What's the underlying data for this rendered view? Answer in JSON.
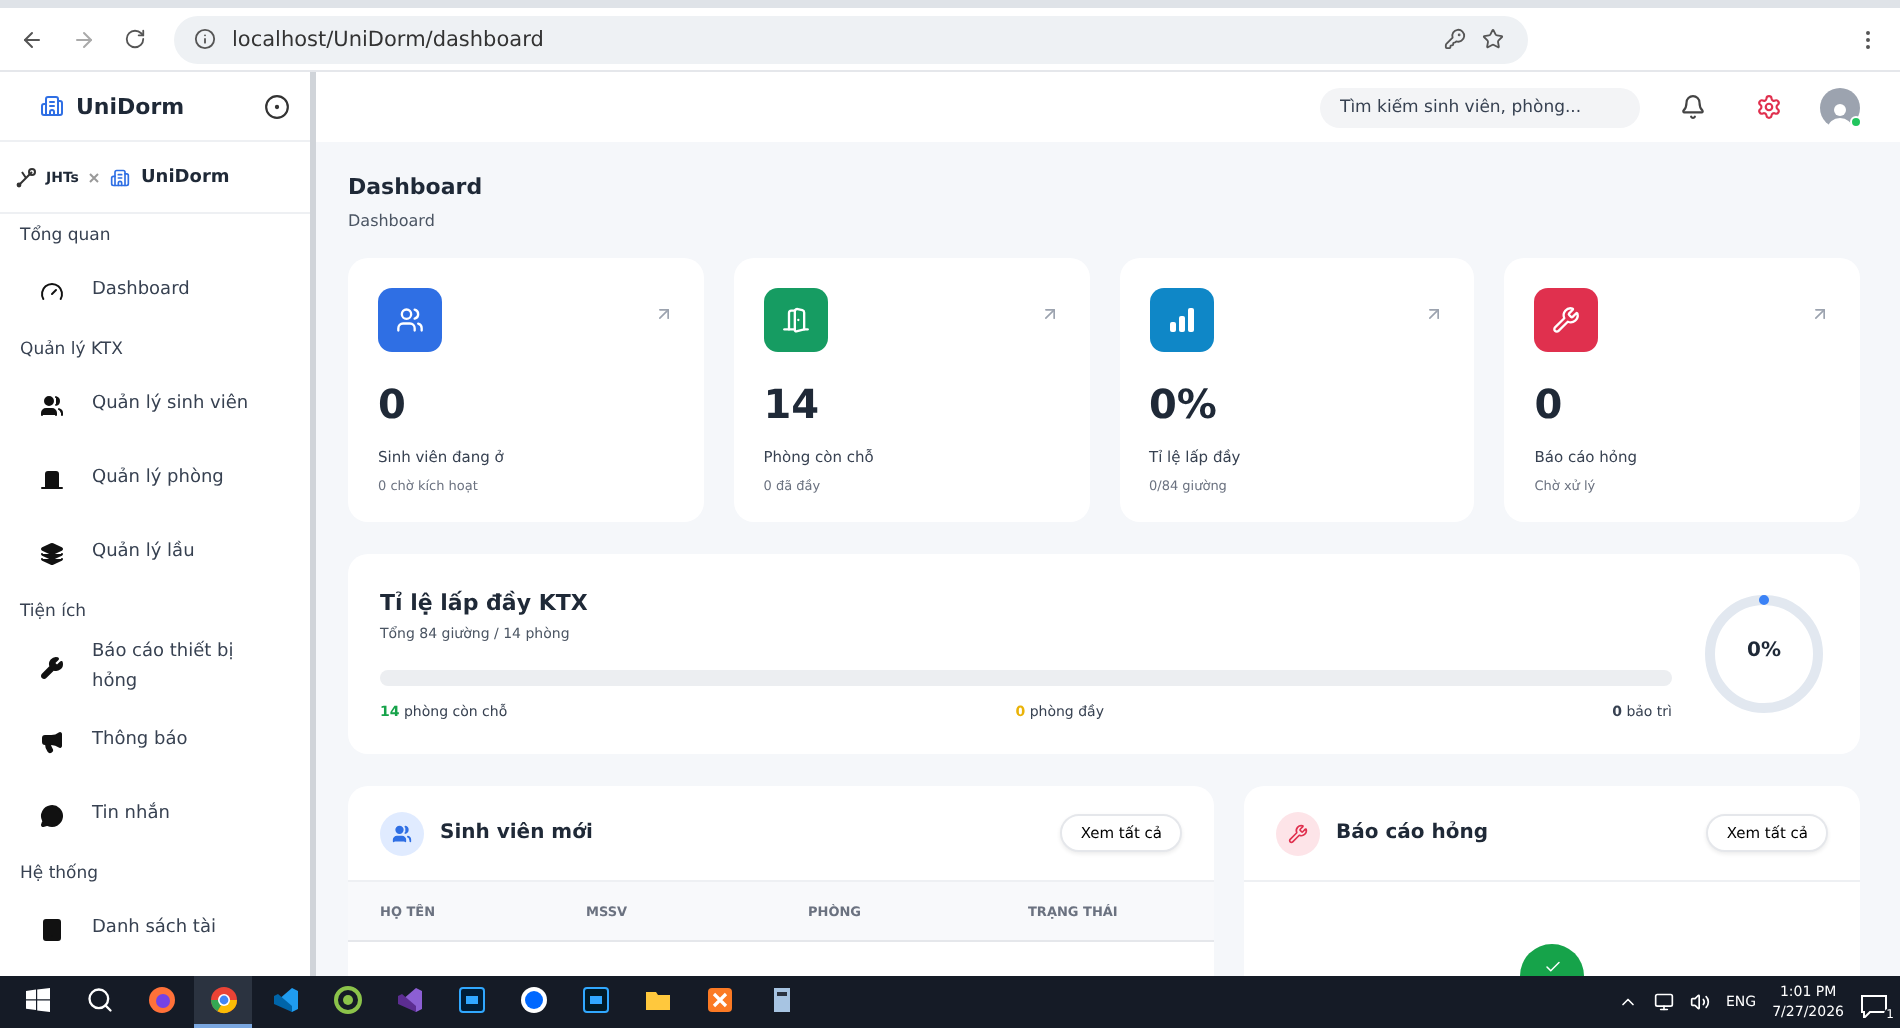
{
  "browser": {
    "url": "localhost/UniDorm/dashboard"
  },
  "sidebar": {
    "brand": "UniDorm",
    "partner": "JHTs",
    "partner_brand": "UniDorm",
    "sections": [
      {
        "title": "Tổng quan",
        "items": [
          {
            "label": "Dashboard"
          }
        ]
      },
      {
        "title": "Quản lý KTX",
        "items": [
          {
            "label": "Quản lý sinh viên"
          },
          {
            "label": "Quản lý phòng"
          },
          {
            "label": "Quản lý lầu"
          }
        ]
      },
      {
        "title": "Tiện ích",
        "items": [
          {
            "label": "Báo cáo thiết bị hỏng"
          },
          {
            "label": "Thông báo"
          },
          {
            "label": "Tin nhắn"
          }
        ]
      },
      {
        "title": "Hệ thống",
        "items": [
          {
            "label": "Danh sách tài"
          }
        ]
      }
    ]
  },
  "topbar": {
    "search": {
      "placeholder": "Tìm kiếm sinh viên, phòng..."
    }
  },
  "page": {
    "title": "Dashboard",
    "breadcrumb": "Dashboard"
  },
  "stats": [
    {
      "value": "0",
      "label": "Sinh viên đang ở",
      "sub": "0 chờ kích hoạt",
      "color": "#2f6fe4"
    },
    {
      "value": "14",
      "label": "Phòng còn chỗ",
      "sub": "0 đã đầy",
      "color": "#169c62"
    },
    {
      "value": "0%",
      "label": "Tỉ lệ lấp đầy",
      "sub": "0/84 giường",
      "color": "#0f87c7"
    },
    {
      "value": "0",
      "label": "Báo cáo hỏng",
      "sub": "Chờ xử lý",
      "color": "#e0304e"
    }
  ],
  "occupancy": {
    "title": "Tỉ lệ lấp đầy KTX",
    "subtitle": "Tổng 84 giường / 14 phòng",
    "level": 0,
    "legend": [
      {
        "value": "14",
        "label": "phòng còn chỗ",
        "color": "#16a34a"
      },
      {
        "value": "0",
        "label": "phòng đầy",
        "color": "#eab308"
      },
      {
        "value": "0",
        "label": "bảo trì",
        "color": "#374151"
      }
    ],
    "ring": {
      "reading": "0%",
      "level": 0
    }
  },
  "students": {
    "title": "Sinh viên mới",
    "button": "Xem tất cả",
    "columns": [
      "HỌ TÊN",
      "MSSV",
      "PHÒNG",
      "TRẠNG THÁI"
    ]
  },
  "reports": {
    "title": "Báo cáo hỏng",
    "button": "Xem tất cả"
  },
  "taskbar": {
    "language": "ENG",
    "time": "1:01 PM",
    "date": "7/27/2026",
    "notifications": "1"
  }
}
